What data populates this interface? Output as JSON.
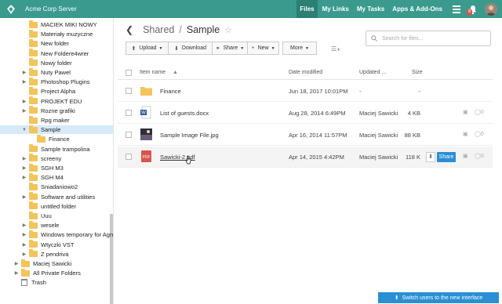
{
  "header": {
    "app_title": "Acme Corp Server",
    "nav": [
      "Files",
      "My Links",
      "My Tasks",
      "Apps & Add-Ons"
    ],
    "active_nav": "Files",
    "notification_count": "8"
  },
  "sidebar": {
    "items": [
      {
        "label": "MACIEK MIKI NOWY",
        "depth": 1,
        "caret": ""
      },
      {
        "label": "Materiały muzyczne",
        "depth": 1,
        "caret": ""
      },
      {
        "label": "New folder",
        "depth": 1,
        "caret": ""
      },
      {
        "label": "New Foldere4wrer",
        "depth": 1,
        "caret": ""
      },
      {
        "label": "Nowy folder",
        "depth": 1,
        "caret": ""
      },
      {
        "label": "Nuty Pawel",
        "depth": 1,
        "caret": "▶"
      },
      {
        "label": "Photoshop Plugins",
        "depth": 1,
        "caret": "▶"
      },
      {
        "label": "Project Alpha",
        "depth": 1,
        "caret": ""
      },
      {
        "label": "PROJEKT EDU",
        "depth": 1,
        "caret": "▶"
      },
      {
        "label": "Rozne grafiki",
        "depth": 1,
        "caret": "▶"
      },
      {
        "label": "Rpg maker",
        "depth": 1,
        "caret": ""
      },
      {
        "label": "Sample",
        "depth": 1,
        "caret": "▼",
        "selected": true
      },
      {
        "label": "Finance",
        "depth": 2,
        "caret": ""
      },
      {
        "label": "Sample trampolina",
        "depth": 1,
        "caret": ""
      },
      {
        "label": "screeny",
        "depth": 1,
        "caret": "▶"
      },
      {
        "label": "SGH M3",
        "depth": 1,
        "caret": "▶"
      },
      {
        "label": "SGH M4",
        "depth": 1,
        "caret": "▶"
      },
      {
        "label": "Sniadaniowo2",
        "depth": 1,
        "caret": ""
      },
      {
        "label": "Software and utilities",
        "depth": 1,
        "caret": "▶"
      },
      {
        "label": "untitled folder",
        "depth": 1,
        "caret": ""
      },
      {
        "label": "Uuu",
        "depth": 1,
        "caret": ""
      },
      {
        "label": "wesele",
        "depth": 1,
        "caret": "▶"
      },
      {
        "label": "Windows temporary for Agni",
        "depth": 1,
        "caret": "▶"
      },
      {
        "label": "Wtyczki VST",
        "depth": 1,
        "caret": "▶"
      },
      {
        "label": "Z pendriva",
        "depth": 1,
        "caret": "▶"
      },
      {
        "label": "Maciej Sawicki",
        "depth": 0,
        "caret": "▶"
      },
      {
        "label": "All Private Folders",
        "depth": 0,
        "caret": "▶"
      },
      {
        "label": "Trash",
        "depth": 0,
        "caret": "",
        "trash": true
      }
    ]
  },
  "breadcrumb": {
    "parent": "Shared",
    "separator": "/",
    "current": "Sample"
  },
  "search": {
    "placeholder": "Search for files..."
  },
  "toolbar": {
    "upload": "Upload",
    "download": "Download",
    "share": "Share",
    "new": "New",
    "more": "More"
  },
  "table": {
    "headers": {
      "name": "Item name",
      "date": "Date modified",
      "updated": "Updated ...",
      "size": "Size"
    },
    "rows": [
      {
        "name": "Finance",
        "date": "Jun 18, 2017 10:01PM",
        "updated_by": "-",
        "size": "-",
        "type": "folder"
      },
      {
        "name": "List of guests.docx",
        "date": "Aug 28, 2014 6:49PM",
        "updated_by": "Maciej Sawicki",
        "size": "4 KB",
        "type": "docx",
        "comments": "0"
      },
      {
        "name": "Sample Image File.jpg",
        "date": "Apr 16, 2014 11:57PM",
        "updated_by": "Maciej Sawicki",
        "size": "88 KB",
        "type": "jpg",
        "comments": "0"
      },
      {
        "name": "Sawicki-2.pdf",
        "date": "Apr 14, 2015 4:42PM",
        "updated_by": "Maciej Sawicki",
        "size": "118 K",
        "type": "pdf",
        "comments": "0",
        "share_label": "Share"
      }
    ]
  },
  "footer": {
    "switch_label": "Switch users to the new interface"
  }
}
